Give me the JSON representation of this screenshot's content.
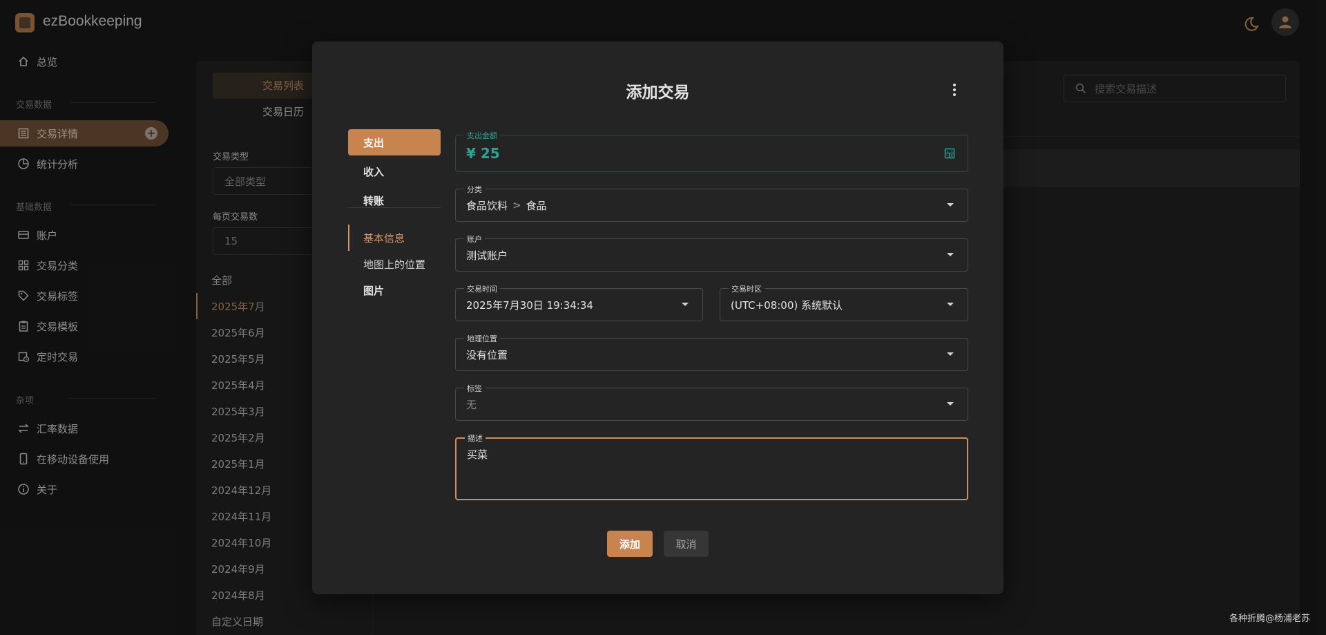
{
  "app": {
    "title": "ezBookkeeping"
  },
  "sidebar": {
    "overview": "总览",
    "section_transactions": "交易数据",
    "transaction_details": "交易详情",
    "statistics": "统计分析",
    "section_basic": "基础数据",
    "accounts": "账户",
    "categories": "交易分类",
    "tags": "交易标签",
    "templates": "交易模板",
    "scheduled": "定时交易",
    "section_misc": "杂项",
    "exchange_rates": "汇率数据",
    "mobile": "在移动设备使用",
    "about": "关于"
  },
  "list_panel": {
    "tabs": [
      "交易列表",
      "交易日历"
    ],
    "type_label": "交易类型",
    "type_value": "全部类型",
    "per_page_label": "每页交易数",
    "per_page_value": "15",
    "months": [
      "全部",
      "2025年7月",
      "2025年6月",
      "2025年5月",
      "2025年4月",
      "2025年3月",
      "2025年2月",
      "2025年1月",
      "2024年12月",
      "2024年11月",
      "2024年10月",
      "2024年9月",
      "2024年8月",
      "自定义日期"
    ],
    "active_month": "2025年7月",
    "search_placeholder": "搜索交易描述"
  },
  "dialog": {
    "title": "添加交易",
    "type_tabs": [
      "支出",
      "收入",
      "转账"
    ],
    "active_type": "支出",
    "sub_tabs": [
      "基本信息",
      "地图上的位置",
      "图片"
    ],
    "fields": {
      "amount": {
        "label": "支出金额",
        "value": "¥ 25"
      },
      "category": {
        "label": "分类",
        "parent": "食品饮料",
        "separator": ">",
        "child": "食品"
      },
      "account": {
        "label": "账户",
        "value": "测试账户"
      },
      "time": {
        "label": "交易时间",
        "value": "2025年7月30日 19:34:34"
      },
      "timezone": {
        "label": "交易时区",
        "value": "(UTC+08:00) 系统默认"
      },
      "location": {
        "label": "地理位置",
        "value": "没有位置"
      },
      "tags": {
        "label": "标签",
        "value": "无"
      },
      "description": {
        "label": "描述",
        "value": "买菜"
      }
    },
    "add_label": "添加",
    "cancel_label": "取消"
  },
  "footer": {
    "note": "各种折腾@杨浦老苏"
  },
  "colors": {
    "accent": "#c7844f",
    "amount": "#2fa295",
    "background": "#191919"
  }
}
